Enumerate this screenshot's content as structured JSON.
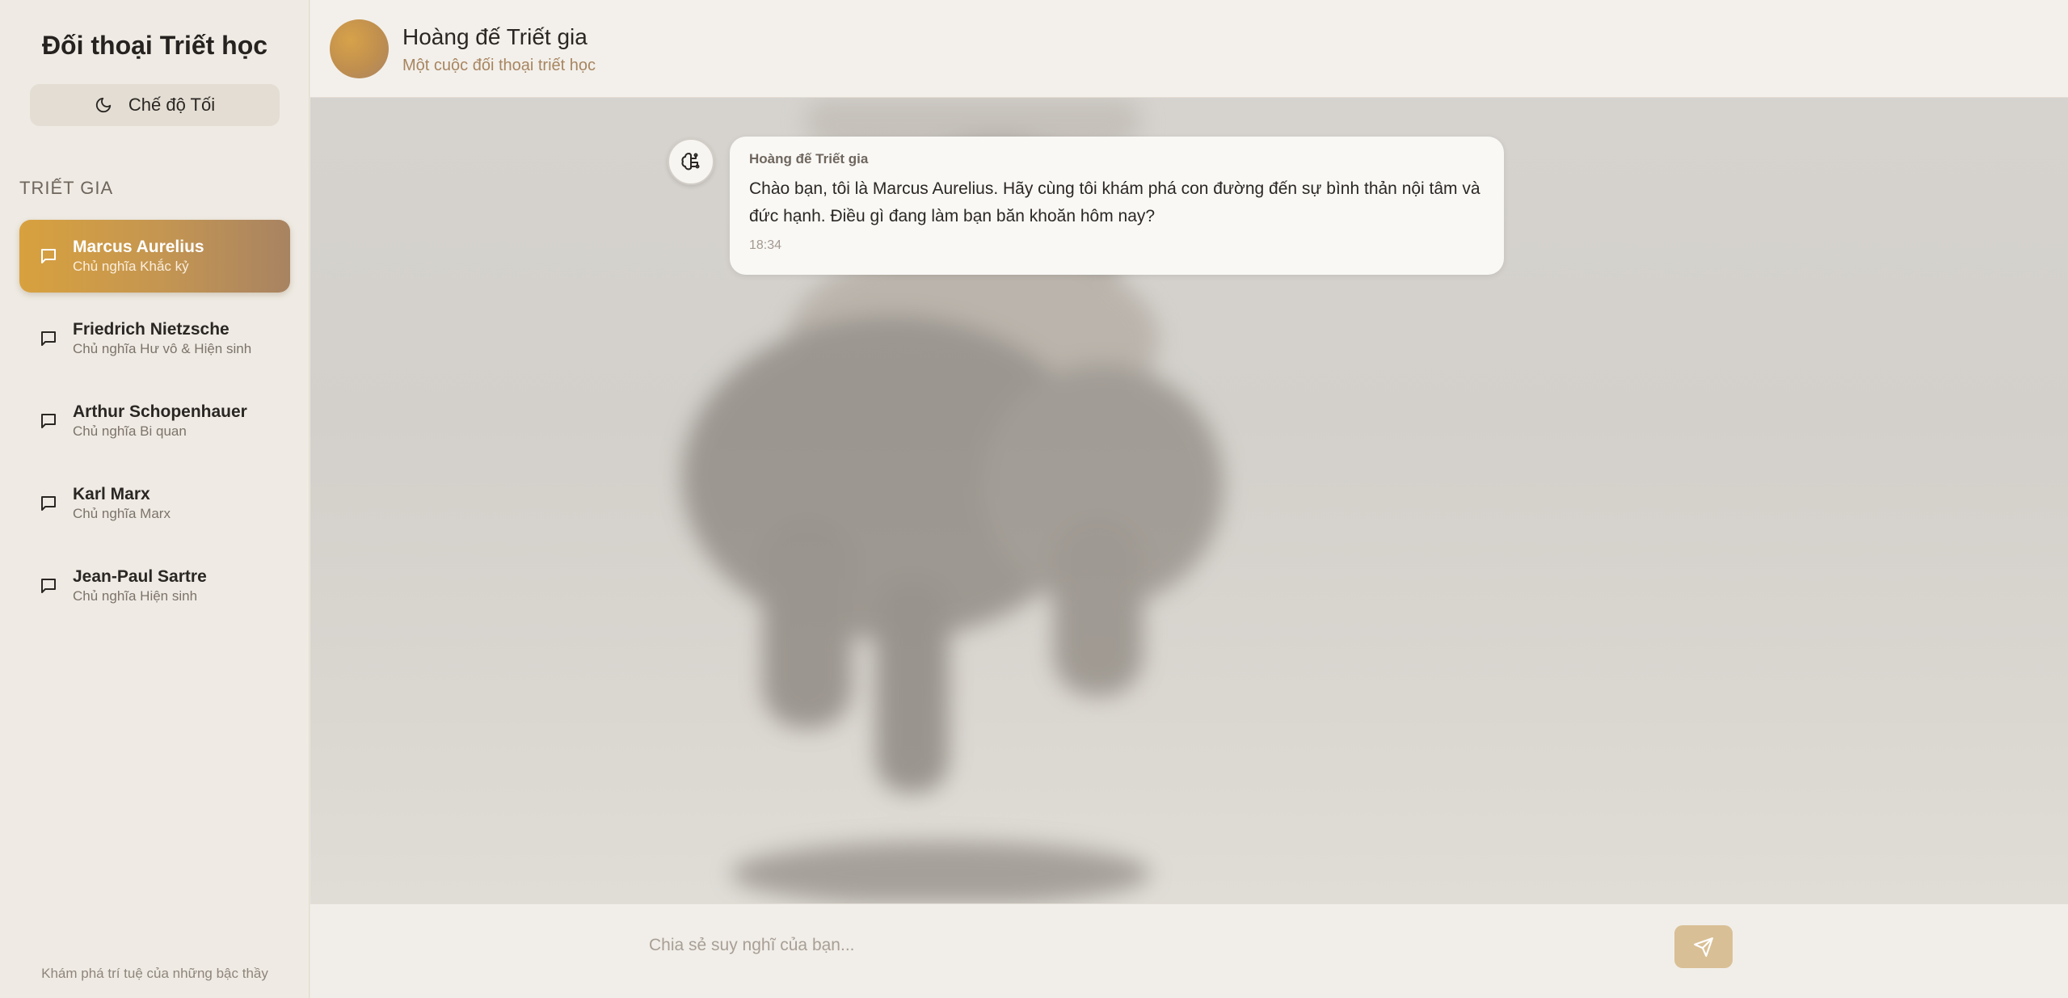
{
  "sidebar": {
    "title": "Đối thoại Triết học",
    "theme_toggle": {
      "label": "Chế độ Tối",
      "icon": "moon-icon"
    },
    "section_label": "TRIẾT GIA",
    "philosophers": [
      {
        "name": "Marcus Aurelius",
        "school": "Chủ nghĩa Khắc kỷ",
        "active": true
      },
      {
        "name": "Friedrich Nietzsche",
        "school": "Chủ nghĩa Hư vô & Hiện sinh",
        "active": false
      },
      {
        "name": "Arthur Schopenhauer",
        "school": "Chủ nghĩa Bi quan",
        "active": false
      },
      {
        "name": "Karl Marx",
        "school": "Chủ nghĩa Marx",
        "active": false
      },
      {
        "name": "Jean-Paul Sartre",
        "school": "Chủ nghĩa Hiện sinh",
        "active": false
      }
    ],
    "footer": "Khám phá trí tuệ của những bậc thầy"
  },
  "header": {
    "title": "Hoàng đế Triết gia",
    "subtitle": "Một cuộc đối thoại triết học"
  },
  "messages": [
    {
      "sender": "Hoàng đế Triết gia",
      "text": "Chào bạn, tôi là Marcus Aurelius. Hãy cùng tôi khám phá con đường đến sự bình thản nội tâm và đức hạnh. Điều gì đang làm bạn băn khoăn hôm nay?",
      "time": "18:34",
      "avatar_icon": "brain-icon"
    }
  ],
  "composer": {
    "placeholder": "Chia sẻ suy nghĩ của bạn...",
    "value": "",
    "send_icon": "send-icon"
  },
  "colors": {
    "accent_start": "#d8a13e",
    "accent_end": "#a88362",
    "send_button": "#d9bf95"
  }
}
